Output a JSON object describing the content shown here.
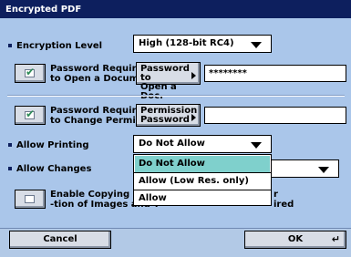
{
  "window": {
    "title": "Encrypted PDF"
  },
  "encryption_level": {
    "label": "Encryption Level",
    "value": "High (128-bit RC4)"
  },
  "open_password": {
    "label_line1": "Password Required",
    "label_line2": "to Open a Document",
    "checked": true,
    "button_line1": "Password to",
    "button_line2": "Open a Doc.",
    "value": "********"
  },
  "permission_password": {
    "label_line1": "Password Required",
    "label_line2": "to Change Permiss.",
    "checked": true,
    "button_line1": "Permission",
    "button_line2": "Password",
    "value": ""
  },
  "allow_printing": {
    "label": "Allow Printing",
    "value": "Do Not Allow",
    "options": [
      "Do Not Allow",
      "Allow (Low Res. only)",
      "Allow"
    ],
    "selected_index": 0
  },
  "allow_changes": {
    "label": "Allow Changes"
  },
  "copying": {
    "label_line1_visible": "Enable Copying and E",
    "label_line2_visible": "-tion of Images and T",
    "partial_right_1": "r",
    "partial_right_2": "ired",
    "checked": false
  },
  "footer": {
    "cancel_label": "Cancel",
    "ok_label": "OK",
    "ok_icon": "enter-icon"
  },
  "colors": {
    "titlebar": "#0d1f5e",
    "panel": "#aac6ea",
    "selected_option": "#7fd0cc"
  }
}
